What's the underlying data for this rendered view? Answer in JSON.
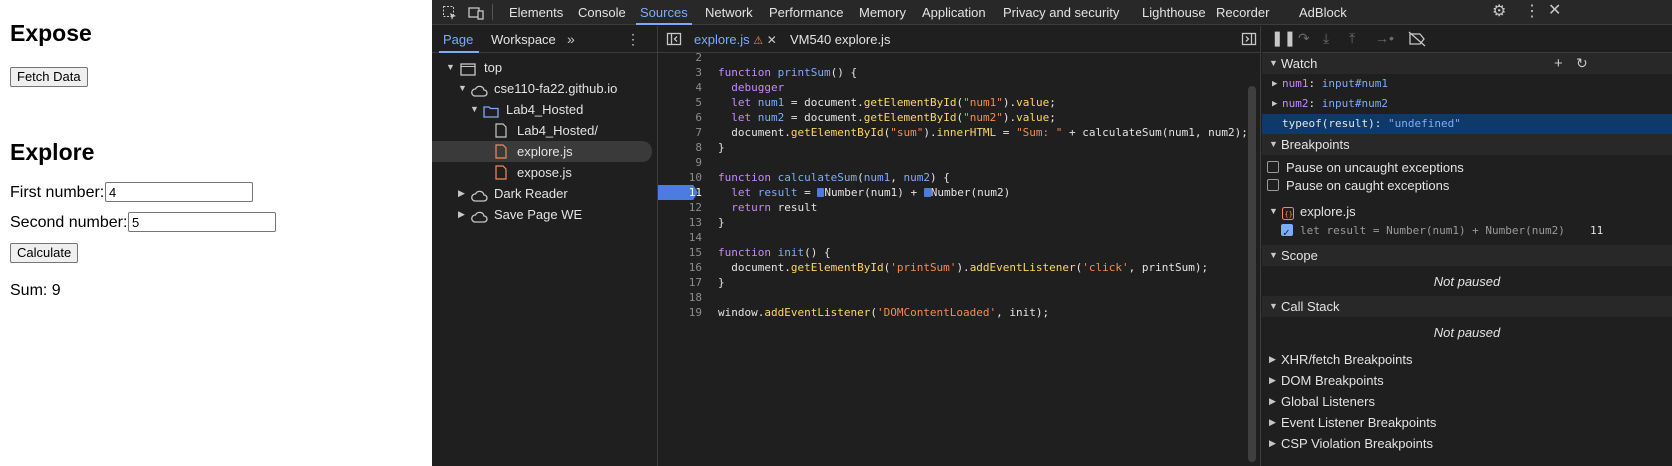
{
  "page": {
    "heading_expose": "Expose",
    "fetch_button": "Fetch Data",
    "heading_explore": "Explore",
    "first_label": "First number:",
    "first_value": "4",
    "second_label": "Second number:",
    "second_value": "5",
    "calculate_button": "Calculate",
    "sum_text": "Sum: 9"
  },
  "devtools": {
    "tabs": [
      "Elements",
      "Console",
      "Sources",
      "Network",
      "Performance",
      "Memory",
      "Application",
      "Privacy and security",
      "Lighthouse",
      "Recorder",
      "AdBlock"
    ],
    "active_tab": "Sources",
    "navigator": {
      "tabs": [
        "Page",
        "Workspace"
      ],
      "tree": [
        {
          "label": "top",
          "icon": "frame-icon",
          "expanded": true
        },
        {
          "label": "cse110-fa22.github.io",
          "icon": "cloud-icon",
          "expanded": true
        },
        {
          "label": "Lab4_Hosted",
          "icon": "folder-icon",
          "expanded": true
        },
        {
          "label": "Lab4_Hosted/",
          "icon": "file-icon"
        },
        {
          "label": "explore.js",
          "icon": "js-file-icon",
          "selected": true
        },
        {
          "label": "expose.js",
          "icon": "js-file-icon"
        },
        {
          "label": "Dark Reader",
          "icon": "cloud-icon",
          "expanded": false
        },
        {
          "label": "Save Page WE",
          "icon": "cloud-icon",
          "expanded": false
        }
      ]
    },
    "editor": {
      "tabs": [
        {
          "label": "explore.js",
          "active": true,
          "warning": true
        },
        {
          "label": "VM540 explore.js",
          "active": false
        }
      ],
      "line_numbers": [
        "2",
        "3",
        "4",
        "5",
        "6",
        "7",
        "8",
        "9",
        "10",
        "11",
        "12",
        "13",
        "14",
        "15",
        "16",
        "17",
        "18",
        "19"
      ],
      "breakpoint_line": "11"
    },
    "watch": {
      "title": "Watch",
      "items": [
        {
          "name": "num1",
          "value": "input#num1"
        },
        {
          "name": "num2",
          "value": "input#num2"
        },
        {
          "name": "typeof(result)",
          "value": "\"undefined\""
        }
      ]
    },
    "breakpoints": {
      "title": "Breakpoints",
      "pause_uncaught": "Pause on uncaught exceptions",
      "pause_caught": "Pause on caught exceptions",
      "file": "explore.js",
      "entry_code": "let result = Number(num1) + Number(num2)",
      "entry_line": "11"
    },
    "scope": {
      "title": "Scope",
      "status": "Not paused"
    },
    "call_stack": {
      "title": "Call Stack",
      "status": "Not paused"
    },
    "more_sections": [
      "XHR/fetch Breakpoints",
      "DOM Breakpoints",
      "Global Listeners",
      "Event Listener Breakpoints",
      "CSP Violation Breakpoints"
    ]
  }
}
